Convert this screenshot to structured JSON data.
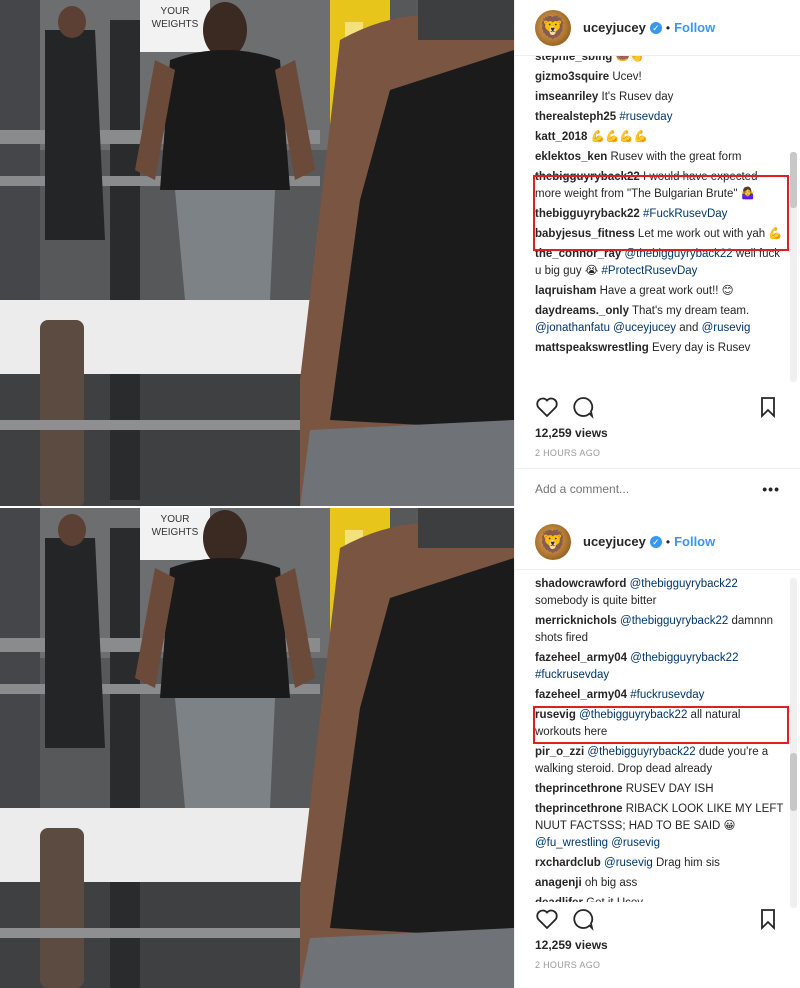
{
  "post1": {
    "sign_text": [
      "YOUR",
      "WEIGHTS"
    ],
    "username": "uceyjucey",
    "follow": "Follow",
    "comments": [
      {
        "u": "stephie_sbing",
        "t": "🍩👏",
        "clip": true
      },
      {
        "u": "gizmo3squire",
        "t": "Ucev!"
      },
      {
        "u": "imseanriley",
        "t": "It's Rusev day"
      },
      {
        "u": "therealsteph25",
        "m": "#rusevday"
      },
      {
        "u": "katt_2018",
        "t": "💪💪💪💪"
      },
      {
        "u": "eklektos_ken",
        "t": "Rusev with the great form"
      },
      {
        "u": "thebigguyryback22",
        "t": "I would have expected more weight from \"The Bulgarian Brute\" 🤷‍♀️"
      },
      {
        "u": "thebigguyryback22",
        "m": "#FuckRusevDay"
      },
      {
        "u": "babyjesus_fitness",
        "t": "Let me work out with yah 💪"
      },
      {
        "u": "the_connor_ray",
        "m": "@thebigguyryback22",
        "t": "well fuck u big guy 😭",
        "m2": "#ProtectRusevDay"
      },
      {
        "u": "laqruisham",
        "t": "Have a great work out!! 😊"
      },
      {
        "u": "daydreams._only",
        "t": "That's my dream team.",
        "m": "@jonathanfatu @uceyjucey",
        "t2": "and",
        "m2": "@rusevig"
      },
      {
        "u": "mattspeakswrestling",
        "t": "Every day is Rusev"
      }
    ],
    "views": "12,259 views",
    "ago": "2 HOURS AGO",
    "add_comment_placeholder": "Add a comment...",
    "more": "•••"
  },
  "post2": {
    "sign_text": [
      "YOUR",
      "WEIGHTS"
    ],
    "username": "uceyjucey",
    "follow": "Follow",
    "comments": [
      {
        "u": "shadowcrawford",
        "m": "@thebigguyryback22",
        "t": "somebody is quite bitter"
      },
      {
        "u": "merricknichols",
        "m": "@thebigguyryback22",
        "t": "damnnn shots fired"
      },
      {
        "u": "fazeheel_army04",
        "m": "@thebigguyryback22 #fuckrusevday"
      },
      {
        "u": "fazeheel_army04",
        "m": "#fuckrusevday"
      },
      {
        "u": "rusevig",
        "m": "@thebigguyryback22",
        "t": "all natural workouts here"
      },
      {
        "u": "pir_o_zzi",
        "m": "@thebigguyryback22",
        "t": "dude you're a walking steroid. Drop dead already"
      },
      {
        "u": "theprincethrone",
        "t": "RUSEV DAY ISH"
      },
      {
        "u": "theprincethrone",
        "t": "RIBACK LOOK LIKE MY LEFT NUUT FACTSSS; HAD TO BE SAID 😀",
        "m": "@fu_wrestling @rusevig"
      },
      {
        "u": "rxchardclub",
        "m": "@rusevig",
        "t": "Drag him sis"
      },
      {
        "u": "anagenji",
        "t": "oh big ass"
      },
      {
        "u": "deadlifer",
        "t": "Get it Ucey",
        "clipb": true
      }
    ],
    "views": "12,259 views",
    "ago": "2 HOURS AGO"
  },
  "colors": {
    "link": "#3897f0",
    "mention": "#003569",
    "highlight": "#e02020"
  }
}
